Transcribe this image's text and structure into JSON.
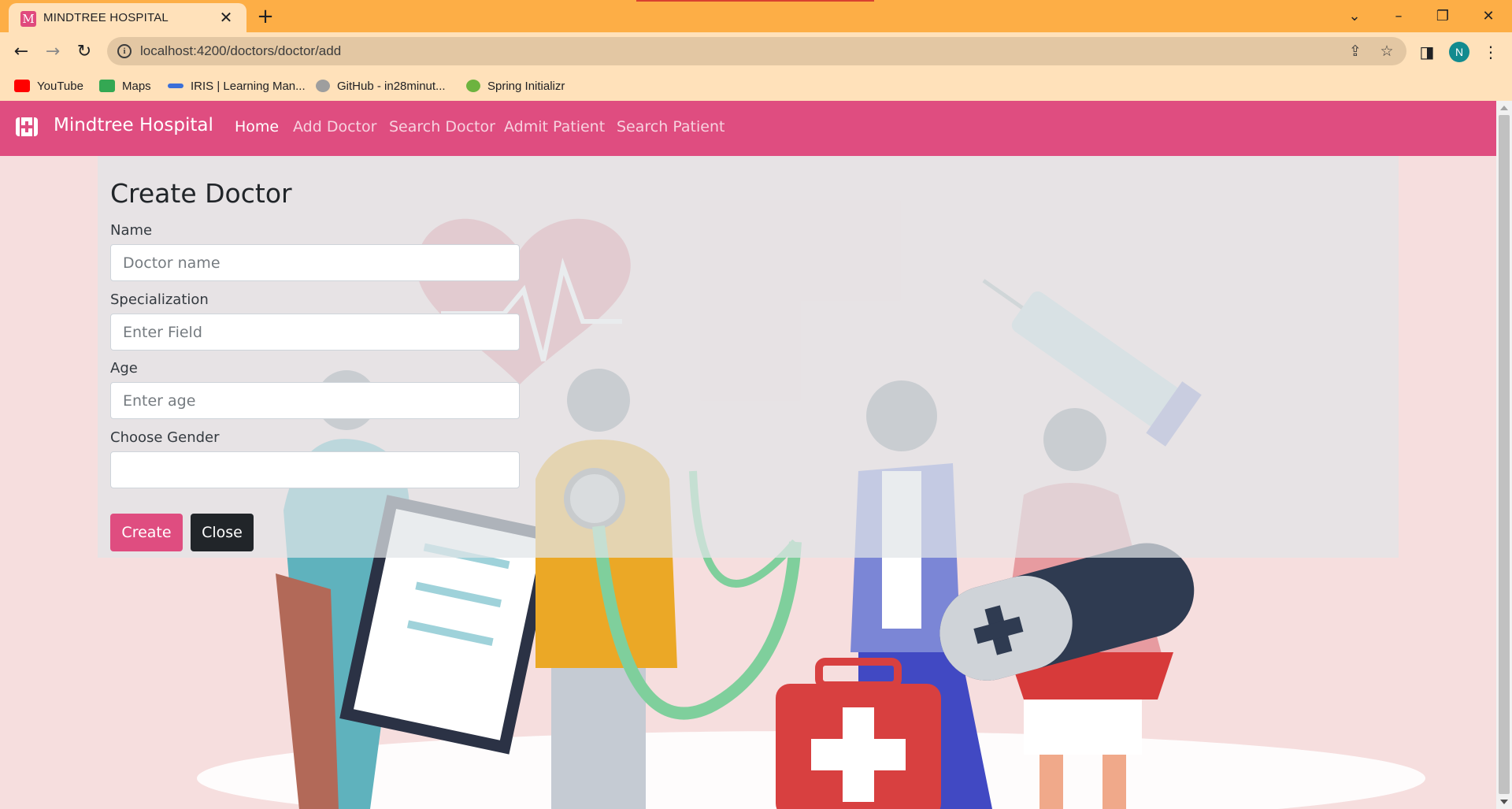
{
  "browser": {
    "tab_title": "MINDTREE HOSPITAL",
    "tab_favicon_letter": "M",
    "url": "localhost:4200/doctors/doctor/add",
    "profile_initial": "N",
    "bookmarks": [
      {
        "label": "YouTube",
        "icon": "youtube-icon",
        "color": "#ff0000"
      },
      {
        "label": "Maps",
        "icon": "maps-icon",
        "color": "#34a853"
      },
      {
        "label": "IRIS | Learning Man...",
        "icon": "iris-icon",
        "color": "#3b6fd8"
      },
      {
        "label": "GitHub - in28minut...",
        "icon": "github-icon",
        "color": "#9e9e9e"
      },
      {
        "label": "Spring Initializr",
        "icon": "spring-icon",
        "color": "#6db33f"
      }
    ]
  },
  "navbar": {
    "brand": "Mindtree Hospital",
    "links": [
      {
        "label": "Home",
        "active": true
      },
      {
        "label": "Add Doctor",
        "active": false
      },
      {
        "label": "Search Doctor",
        "active": false
      },
      {
        "label": "Admit Patient",
        "active": false
      },
      {
        "label": "Search Patient",
        "active": false
      }
    ],
    "color": "#df4d80"
  },
  "form": {
    "title": "Create Doctor",
    "fields": [
      {
        "label": "Name",
        "placeholder": "Doctor name",
        "value": ""
      },
      {
        "label": "Specialization",
        "placeholder": "Enter Field",
        "value": ""
      },
      {
        "label": "Age",
        "placeholder": "Enter age",
        "value": ""
      },
      {
        "label": "Choose Gender",
        "placeholder": "",
        "value": ""
      }
    ],
    "buttons": {
      "create": "Create",
      "close": "Close"
    }
  },
  "colors": {
    "chrome_tabbar": "#fdae46",
    "chrome_toolbar": "#ffe1ba",
    "primary": "#df4d80",
    "dark": "#212529"
  }
}
